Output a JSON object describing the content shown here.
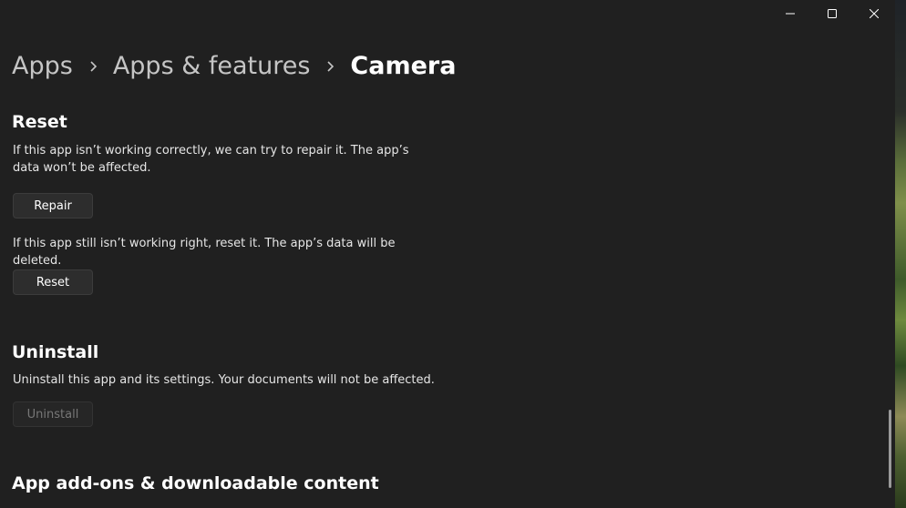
{
  "window": {
    "controls": {
      "minimize_icon": "minimize-icon",
      "maximize_icon": "maximize-icon",
      "close_icon": "close-icon"
    }
  },
  "breadcrumb": {
    "items": [
      "Apps",
      "Apps & features",
      "Camera"
    ],
    "separator_icon": "chevron-right-icon"
  },
  "reset_section": {
    "title": "Reset",
    "repair_description": "If this app isn’t working correctly, we can try to repair it. The app’s data won’t be affected.",
    "repair_button": "Repair",
    "reset_description": "If this app still isn’t working right, reset it. The app’s data will be deleted.",
    "reset_button": "Reset"
  },
  "uninstall_section": {
    "title": "Uninstall",
    "description": "Uninstall this app and its settings. Your documents will not be affected.",
    "uninstall_button": "Uninstall",
    "uninstall_button_state": "disabled"
  },
  "addons_section": {
    "title": "App add-ons & downloadable content"
  },
  "colors": {
    "background": "#202020",
    "text_primary": "#ffffff",
    "text_secondary": "#c5c5c5",
    "button_bg": "#2d2d2d",
    "button_disabled_text": "#777777"
  }
}
